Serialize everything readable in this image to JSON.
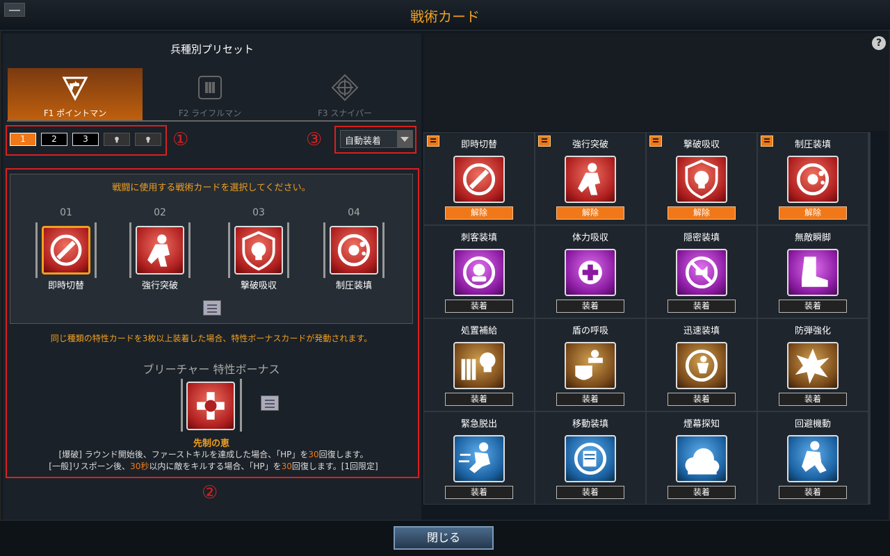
{
  "window": {
    "title": "戦術カード",
    "help": "?"
  },
  "preset": {
    "title": "兵種別プリセット",
    "classes": [
      {
        "label": "F1 ポイントマン",
        "icon": "pointman-icon",
        "active": true
      },
      {
        "label": "F2 ライフルマン",
        "icon": "rifleman-icon",
        "active": false
      },
      {
        "label": "F3 スナイパー",
        "icon": "sniper-icon",
        "active": false
      }
    ],
    "slots": [
      "1",
      "2",
      "3"
    ],
    "locked_slots": 2
  },
  "markers": {
    "one": "①",
    "two": "②",
    "three": "③"
  },
  "auto_equip": {
    "label": "自動装着"
  },
  "selected": {
    "instruction": "戦闘に使用する戦術カードを選択してください。",
    "cards": [
      {
        "num": "01",
        "name": "即時切替",
        "color": "red",
        "icon": "instant-swap-icon"
      },
      {
        "num": "02",
        "name": "強行突破",
        "color": "red",
        "icon": "breakthrough-icon"
      },
      {
        "num": "03",
        "name": "撃破吸収",
        "color": "red",
        "icon": "kill-absorb-icon"
      },
      {
        "num": "04",
        "name": "制圧装填",
        "color": "red",
        "icon": "suppress-reload-icon"
      }
    ]
  },
  "bonus": {
    "instruction": "同じ種類の特性カードを3枚以上装着した場合、特性ボーナスカードが発動されます。",
    "title": "ブリーチャー 特性ボーナス",
    "name": "先制の恵",
    "line1_a": "[爆破] ラウンド開始後、ファーストキルを達成した場合、「HP」を",
    "line1_b": "30",
    "line1_c": "回復します。",
    "line2_a": "[一般]リスポーン後、",
    "line2_b": "30秒",
    "line2_c": "以内に敵をキルする場合、「HP」を",
    "line2_d": "30",
    "line2_e": "回復します。[1回限定]"
  },
  "grid": [
    {
      "name": "即時切替",
      "btn": "解除",
      "equipped": true,
      "color": "red",
      "icon": "instant-swap-icon"
    },
    {
      "name": "強行突破",
      "btn": "解除",
      "equipped": true,
      "color": "red",
      "icon": "breakthrough-icon"
    },
    {
      "name": "撃破吸収",
      "btn": "解除",
      "equipped": true,
      "color": "red",
      "icon": "kill-absorb-icon"
    },
    {
      "name": "制圧装填",
      "btn": "解除",
      "equipped": true,
      "color": "red",
      "icon": "suppress-reload-icon"
    },
    {
      "name": "刺客装填",
      "btn": "装着",
      "equipped": false,
      "color": "purple",
      "icon": "assassin-reload-icon"
    },
    {
      "name": "体力吸収",
      "btn": "装着",
      "equipped": false,
      "color": "purple",
      "icon": "health-absorb-icon"
    },
    {
      "name": "隠密装填",
      "btn": "装着",
      "equipped": false,
      "color": "purple",
      "icon": "stealth-reload-icon"
    },
    {
      "name": "無敵瞬脚",
      "btn": "装着",
      "equipped": false,
      "color": "purple",
      "icon": "boot-icon"
    },
    {
      "name": "処置補給",
      "btn": "装着",
      "equipped": false,
      "color": "brown",
      "icon": "ammo-skull-icon"
    },
    {
      "name": "盾の呼吸",
      "btn": "装着",
      "equipped": false,
      "color": "brown",
      "icon": "shield-soldier-icon"
    },
    {
      "name": "迅速装填",
      "btn": "装着",
      "equipped": false,
      "color": "brown",
      "icon": "quick-reload-icon"
    },
    {
      "name": "防弾強化",
      "btn": "装着",
      "equipped": false,
      "color": "brown",
      "icon": "armor-burst-icon"
    },
    {
      "name": "緊急脱出",
      "btn": "装着",
      "equipped": false,
      "color": "blue",
      "icon": "escape-icon"
    },
    {
      "name": "移動装填",
      "btn": "装着",
      "equipped": false,
      "color": "blue",
      "icon": "move-reload-icon"
    },
    {
      "name": "煙幕探知",
      "btn": "装着",
      "equipped": false,
      "color": "blue",
      "icon": "smoke-detect-icon"
    },
    {
      "name": "回避機動",
      "btn": "装着",
      "equipped": false,
      "color": "blue",
      "icon": "evade-icon"
    }
  ],
  "footer": {
    "close": "閉じる"
  }
}
